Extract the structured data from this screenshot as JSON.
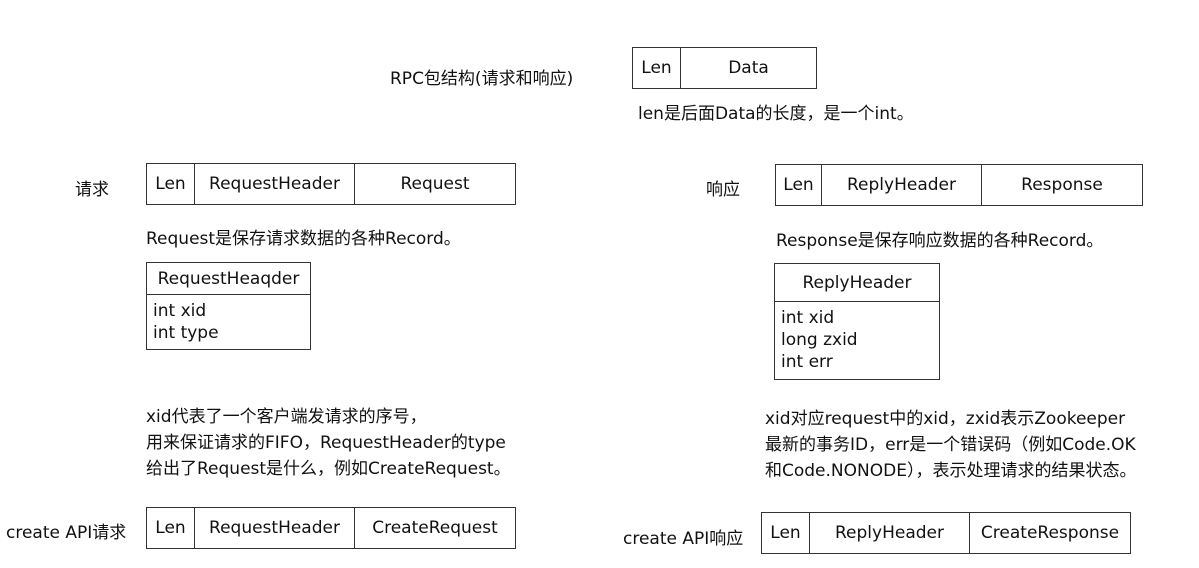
{
  "header": {
    "title": "RPC包结构(请求和响应)",
    "packet": [
      "Len",
      "Data"
    ],
    "note": "len是后面Data的长度，是一个int。"
  },
  "request": {
    "label": "请求",
    "packet": [
      "Len",
      "RequestHeader",
      "Request"
    ],
    "note": "Request是保存请求数据的各种Record。",
    "header_struct": {
      "title": "RequestHeaqder",
      "fields": [
        "int xid",
        "int type"
      ]
    },
    "explain": [
      "xid代表了一个客户端发请求的序号，",
      "用来保证请求的FIFO，RequestHeader的type",
      "给出了Request是什么，例如CreateRequest。"
    ],
    "create_label": "create API请求",
    "create_packet": [
      "Len",
      "RequestHeader",
      "CreateRequest"
    ]
  },
  "response": {
    "label": "响应",
    "packet": [
      "Len",
      "ReplyHeader",
      "Response"
    ],
    "note": "Response是保存响应数据的各种Record。",
    "header_struct": {
      "title": "ReplyHeader",
      "fields": [
        "int xid",
        "long zxid",
        "int err"
      ]
    },
    "explain": [
      "xid对应request中的xid，zxid表示Zookeeper",
      "最新的事务ID，err是一个错误码（例如Code.OK",
      "和Code.NONODE），表示处理请求的结果状态。"
    ],
    "create_label": "create API响应",
    "create_packet": [
      "Len",
      "ReplyHeader",
      "CreateResponse"
    ]
  }
}
